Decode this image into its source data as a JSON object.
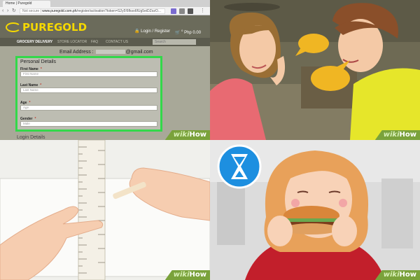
{
  "watermark": {
    "wiki": "wiki",
    "how": "How"
  },
  "browser": {
    "tab_label": "Home | Puregold",
    "url_security": "Not secure",
    "url_host": "www.puregold.com.ph",
    "url_path": "/register/activation?token=S2y5!6fkso6fUg5eiDZozO...",
    "site": {
      "logo": "PUREGOLD",
      "login_label": "Login / Register",
      "cart_label": "Php 0.00",
      "cart_count": "0",
      "nav": [
        "GROCERY DELIVERY",
        "STORE LOCATOR",
        "FAQ",
        "CONTACT US"
      ],
      "search_placeholder": "Search"
    },
    "email_label": "Email Address :",
    "email_suffix": "@gmail.com",
    "form": {
      "section_title": "Personal Details",
      "fields": [
        {
          "label": "First Name",
          "placeholder": "First Name"
        },
        {
          "label": "Last Name",
          "placeholder": "Last Name"
        },
        {
          "label": "Age",
          "placeholder": "Age"
        },
        {
          "label": "Gender",
          "placeholder": "Male"
        }
      ],
      "required_mark": "*"
    },
    "next_section": "Login Details"
  },
  "colors": {
    "accent_green": "#33d84a",
    "wikihow_green": "#7aa23b",
    "brand_yellow": "#f5d800",
    "speech_bubble": "#f0b623"
  },
  "icons": [
    "hourglass-icon",
    "speech-bubble-icon"
  ]
}
